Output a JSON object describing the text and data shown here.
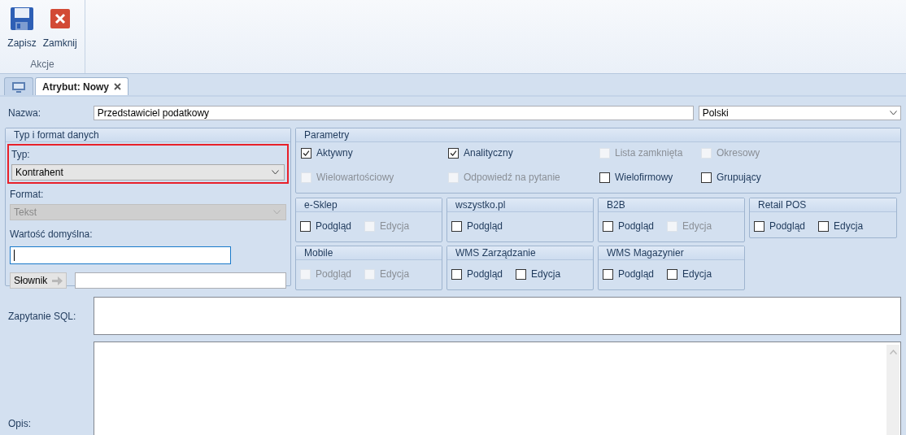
{
  "ribbon": {
    "buttons": [
      {
        "label": "Zapisz",
        "kind": "save"
      },
      {
        "label": "Zamknij",
        "kind": "close"
      }
    ],
    "group": "Akcje"
  },
  "tabs": [
    {
      "kind": "icon",
      "selected": false
    },
    {
      "kind": "text",
      "label": "Atrybut: Nowy",
      "selected": true
    }
  ],
  "name_row": {
    "label": "Nazwa:",
    "value": "Przedstawiciel podatkowy",
    "language": "Polski"
  },
  "type_panel": {
    "title": "Typ i format danych",
    "type_label": "Typ:",
    "type_value": "Kontrahent",
    "highlighted": true,
    "format_label": "Format:",
    "format_value": "Tekst",
    "format_disabled": true,
    "default_label": "Wartość domyślna:",
    "dictionary_button": "Słownik"
  },
  "parameters": {
    "title": "Parametry",
    "items": [
      {
        "label": "Aktywny",
        "checked": true,
        "disabled": false
      },
      {
        "label": "Analityczny",
        "checked": true,
        "disabled": false
      },
      {
        "label": "Lista zamknięta",
        "checked": false,
        "disabled": true
      },
      {
        "label": "Okresowy",
        "checked": false,
        "disabled": true
      },
      {
        "label": "Wielowartościowy",
        "checked": false,
        "disabled": true
      },
      {
        "label": "Odpowiedź na pytanie",
        "checked": false,
        "disabled": true
      },
      {
        "label": "Wielofirmowy",
        "checked": false,
        "disabled": false
      },
      {
        "label": "Grupujący",
        "checked": false,
        "disabled": false
      }
    ]
  },
  "modules": [
    {
      "title": "e-Sklep",
      "options": [
        {
          "label": "Podgląd",
          "checked": false,
          "disabled": false
        },
        {
          "label": "Edycja",
          "checked": false,
          "disabled": true
        }
      ]
    },
    {
      "title": "wszystko.pl",
      "options": [
        {
          "label": "Podgląd",
          "checked": false,
          "disabled": false
        }
      ]
    },
    {
      "title": "B2B",
      "options": [
        {
          "label": "Podgląd",
          "checked": false,
          "disabled": false
        },
        {
          "label": "Edycja",
          "checked": false,
          "disabled": true
        }
      ]
    },
    {
      "title": "Retail POS",
      "options": [
        {
          "label": "Podgląd",
          "checked": false,
          "disabled": false
        },
        {
          "label": "Edycja",
          "checked": false,
          "disabled": false
        }
      ]
    },
    {
      "title": "Mobile",
      "options": [
        {
          "label": "Podgląd",
          "checked": false,
          "disabled": true
        },
        {
          "label": "Edycja",
          "checked": false,
          "disabled": true
        }
      ]
    },
    {
      "title": "WMS Zarządzanie",
      "options": [
        {
          "label": "Podgląd",
          "checked": false,
          "disabled": false
        },
        {
          "label": "Edycja",
          "checked": false,
          "disabled": false
        }
      ]
    },
    {
      "title": "WMS Magazynier",
      "options": [
        {
          "label": "Podgląd",
          "checked": false,
          "disabled": false
        },
        {
          "label": "Edycja",
          "checked": false,
          "disabled": false
        }
      ]
    }
  ],
  "sql_label": "Zapytanie SQL:",
  "description_label": "Opis:"
}
